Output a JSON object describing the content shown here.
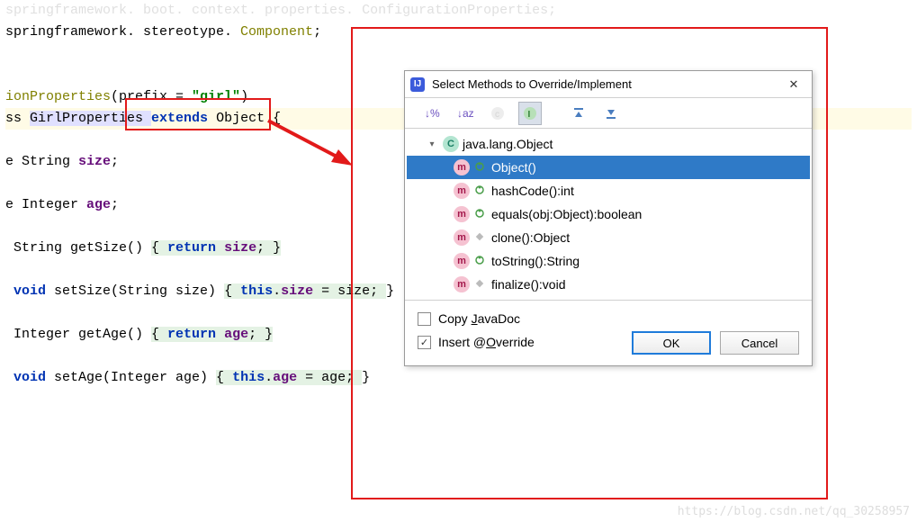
{
  "code": {
    "line0_prefix": "springframework. stereotype. ",
    "line0_comp": "Component",
    "line0_suffix": ";",
    "ann_prefix": "ionProperties",
    "ann_paren_open": "(prefix = ",
    "ann_value": "\"girl\"",
    "ann_paren_close": ")",
    "cls_ss": "ss ",
    "cls_name": "GirlProperties ",
    "cls_extends": "extends",
    "cls_space": " ",
    "cls_object": "Object",
    "cls_brace": " {",
    "f1_pre": "e String ",
    "f1_name": "size",
    "f1_end": ";",
    "f2_pre": "e Integer ",
    "f2_name": "age",
    "f2_end": ";",
    "g1_pre": " String getSize() ",
    "g1_ret_open": "{ ",
    "g1_return": "return",
    "g1_ret_field": " size",
    "g1_ret_close": "; }",
    "s1_void": " void",
    "s1_sig": " setSize(String size) ",
    "s1_body_open": "{ ",
    "s1_this": "this",
    "s1_dot": ".",
    "s1_field": "size",
    "s1_assign": " = size; ",
    "s1_close": "}",
    "g2_pre": " Integer getAge() ",
    "g2_ret_open": "{ ",
    "g2_return": "return",
    "g2_ret_field": " age",
    "g2_ret_close": "; }",
    "s2_void": " void",
    "s2_sig": " setAge(Integer age) ",
    "s2_body_open": "{ ",
    "s2_this": "this",
    "s2_dot": ".",
    "s2_field": "age",
    "s2_assign": " = age; ",
    "s2_close": "}"
  },
  "dialog": {
    "title": "Select Methods to Override/Implement",
    "root_label": "java.lang.Object",
    "methods": [
      {
        "label": "Object()",
        "vis": "public"
      },
      {
        "label": "hashCode():int",
        "vis": "public"
      },
      {
        "label": "equals(obj:Object):boolean",
        "vis": "public"
      },
      {
        "label": "clone():Object",
        "vis": "protected"
      },
      {
        "label": "toString():String",
        "vis": "public"
      },
      {
        "label": "finalize():void",
        "vis": "protected"
      }
    ],
    "copy_javadoc": "Copy JavaDoc",
    "insert_override_pre": "Insert @",
    "insert_override_under": "O",
    "insert_override_post": "verride",
    "javadoc_under": "J",
    "javadoc_post": "avaDoc",
    "javadoc_pre": "Copy ",
    "ok": "OK",
    "cancel": "Cancel",
    "close": "✕"
  },
  "watermark": "https://blog.csdn.net/qq_30258957"
}
